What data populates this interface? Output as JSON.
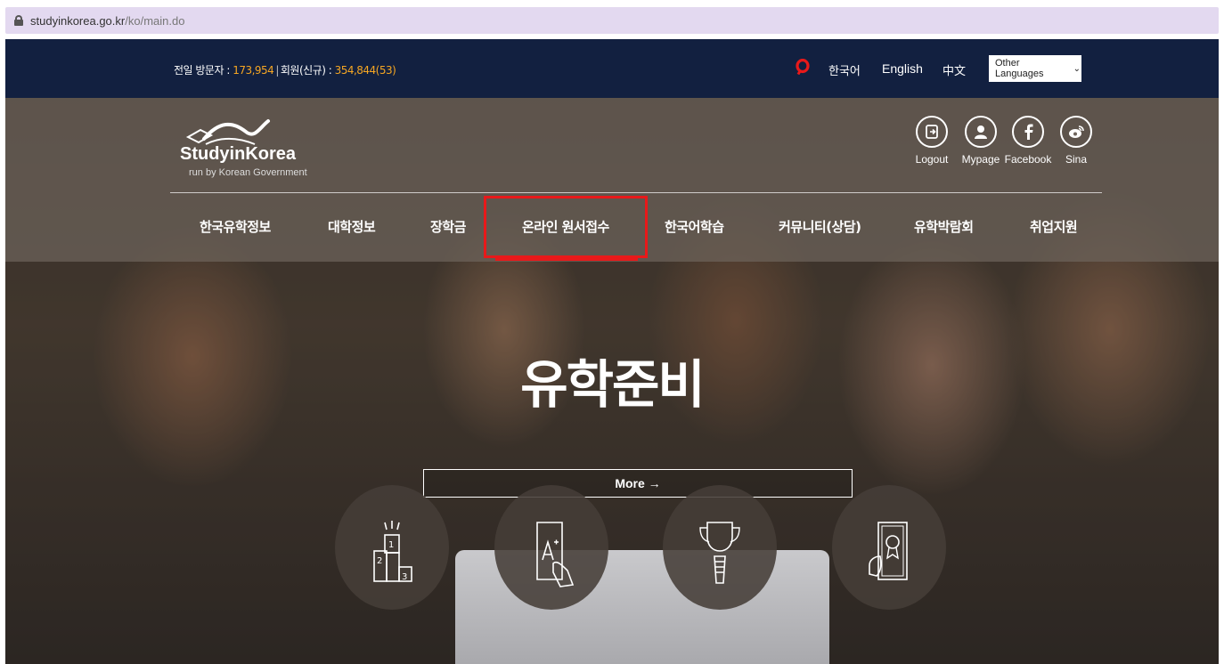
{
  "browser": {
    "url_domain": "studyinkorea.go.kr",
    "url_path": "/ko/main.do"
  },
  "topbar": {
    "visitors_label": "전일 방문자 : ",
    "visitors_count": "173,954",
    "separator": "|",
    "members_label": "회원(신규) : ",
    "members_count": "354,844(53)",
    "languages": [
      "한국어",
      "English",
      "中文"
    ],
    "other_languages": "Other Languages"
  },
  "header": {
    "logo_title": "StudyinKorea",
    "logo_subtitle": "run by Korean Government",
    "util_links": [
      "Logout",
      "Mypage",
      "Facebook",
      "Sina"
    ]
  },
  "nav": {
    "items": [
      "한국유학정보",
      "대학정보",
      "장학금",
      "온라인 원서접수",
      "한국어학습",
      "커뮤니티(상담)",
      "유학박람회",
      "취업지원"
    ],
    "highlighted_index": 3
  },
  "hero": {
    "headline": "유학준비",
    "more_button": "More →"
  },
  "colors": {
    "topbar_bg": "#122040",
    "accent_number": "#f5a623",
    "highlight_red": "#e8191a",
    "urlbar_bg": "#e3d9f0"
  },
  "icons": {
    "lang_search": "search-icon",
    "util": [
      "logout-icon",
      "mypage-icon",
      "facebook-icon",
      "sina-icon"
    ],
    "quick": [
      "ranking-podium-icon",
      "a-plus-grade-icon",
      "trophy-icon",
      "certificate-icon"
    ]
  }
}
